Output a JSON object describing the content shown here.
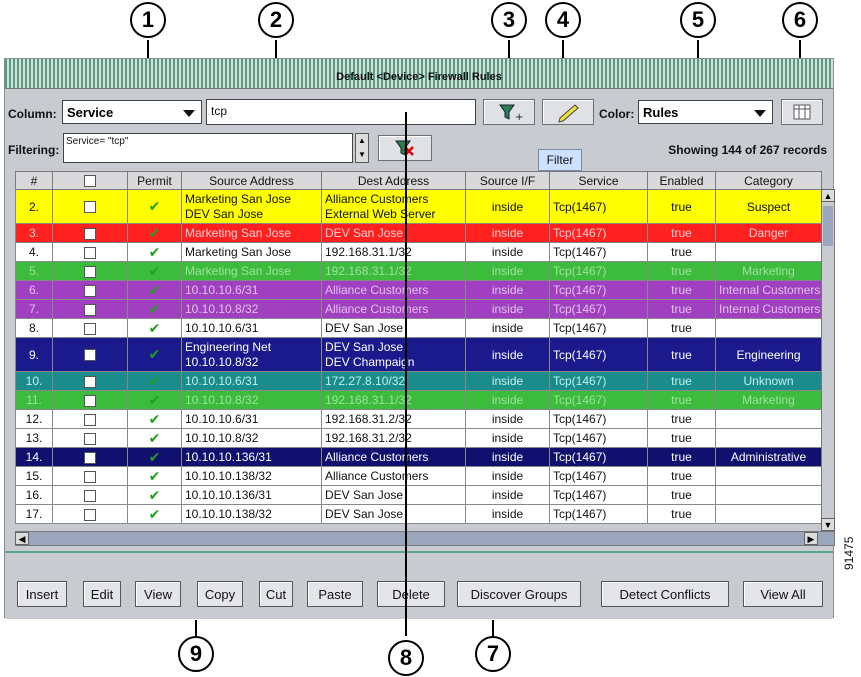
{
  "window": {
    "title": "Default <Device> Firewall Rules"
  },
  "toolbar": {
    "column_label": "Column:",
    "column_value": "Service",
    "filter_text": "tcp",
    "color_label": "Color:",
    "color_value": "Rules",
    "filtering_label": "Filtering:",
    "filtering_expr": "Service= \"tcp\"",
    "tooltip": "Filter",
    "status": "Showing 144 of 267 records"
  },
  "table": {
    "headers": [
      "#",
      "",
      "Permit",
      "Source Address",
      "Dest Address",
      "Source I/F",
      "Service",
      "Enabled",
      "Category"
    ],
    "rows": [
      {
        "num": "2.",
        "src": [
          "Marketing San Jose",
          "DEV San Jose"
        ],
        "dst": [
          "Alliance Customers",
          "External Web Server"
        ],
        "if": "inside",
        "svc": "Tcp(1467)",
        "en": "true",
        "cat": "Suspect",
        "bg": "#ffff00",
        "fg": "#111111",
        "tall": true
      },
      {
        "num": "3.",
        "src": [
          "Marketing San Jose"
        ],
        "dst": [
          "DEV San Jose"
        ],
        "if": "inside",
        "svc": "Tcp(1467)",
        "en": "true",
        "cat": "Danger",
        "bg": "#ff2020",
        "fg": "#ffd0d0"
      },
      {
        "num": "4.",
        "src": [
          "Marketing San Jose"
        ],
        "dst": [
          "192.168.31.1/32"
        ],
        "if": "inside",
        "svc": "Tcp(1467)",
        "en": "true",
        "cat": "",
        "bg": "#ffffff",
        "fg": "#111111"
      },
      {
        "num": "5.",
        "src": [
          "Marketing San Jose"
        ],
        "dst": [
          "192.168.31.1/32"
        ],
        "if": "inside",
        "svc": "Tcp(1467)",
        "en": "true",
        "cat": "Marketing",
        "bg": "#3dbb3d",
        "fg": "#9fe09f"
      },
      {
        "num": "6.",
        "src": [
          "10.10.10.6/31"
        ],
        "dst": [
          "Alliance Customers"
        ],
        "if": "inside",
        "svc": "Tcp(1467)",
        "en": "true",
        "cat": "Internal Customers",
        "bg": "#a040c0",
        "fg": "#e0c0f0"
      },
      {
        "num": "7.",
        "src": [
          "10.10.10.8/32"
        ],
        "dst": [
          "Alliance Customers"
        ],
        "if": "inside",
        "svc": "Tcp(1467)",
        "en": "true",
        "cat": "Internal Customers",
        "bg": "#a040c0",
        "fg": "#e0c0f0"
      },
      {
        "num": "8.",
        "src": [
          "10.10.10.6/31"
        ],
        "dst": [
          "DEV San Jose"
        ],
        "if": "inside",
        "svc": "Tcp(1467)",
        "en": "true",
        "cat": "",
        "bg": "#ffffff",
        "fg": "#111111"
      },
      {
        "num": "9.",
        "src": [
          "Engineering Net",
          "10.10.10.8/32"
        ],
        "dst": [
          "DEV San Jose",
          "DEV Champaign"
        ],
        "if": "inside",
        "svc": "Tcp(1467)",
        "en": "true",
        "cat": "Engineering",
        "bg": "#1a1a8c",
        "fg": "#ffffff",
        "tall": true
      },
      {
        "num": "10.",
        "src": [
          "10.10.10.6/31"
        ],
        "dst": [
          "172.27.8.10/32"
        ],
        "if": "inside",
        "svc": "Tcp(1467)",
        "en": "true",
        "cat": "Unknown",
        "bg": "#1a8c8c",
        "fg": "#c0f0f0"
      },
      {
        "num": "11.",
        "src": [
          "10.10.10.8/32"
        ],
        "dst": [
          "192.168.31.1/32"
        ],
        "if": "inside",
        "svc": "Tcp(1467)",
        "en": "true",
        "cat": "Marketing",
        "bg": "#3dbb3d",
        "fg": "#9fe09f"
      },
      {
        "num": "12.",
        "src": [
          "10.10.10.6/31"
        ],
        "dst": [
          "192.168.31.2/32"
        ],
        "if": "inside",
        "svc": "Tcp(1467)",
        "en": "true",
        "cat": "",
        "bg": "#ffffff",
        "fg": "#111111"
      },
      {
        "num": "13.",
        "src": [
          "10.10.10.8/32"
        ],
        "dst": [
          "192.168.31.2/32"
        ],
        "if": "inside",
        "svc": "Tcp(1467)",
        "en": "true",
        "cat": "",
        "bg": "#ffffff",
        "fg": "#111111"
      },
      {
        "num": "14.",
        "src": [
          "10.10.10.136/31"
        ],
        "dst": [
          "Alliance Customers"
        ],
        "if": "inside",
        "svc": "Tcp(1467)",
        "en": "true",
        "cat": "Administrative",
        "bg": "#10106e",
        "fg": "#ffffff"
      },
      {
        "num": "15.",
        "src": [
          "10.10.10.138/32"
        ],
        "dst": [
          "Alliance Customers"
        ],
        "if": "inside",
        "svc": "Tcp(1467)",
        "en": "true",
        "cat": "",
        "bg": "#ffffff",
        "fg": "#111111"
      },
      {
        "num": "16.",
        "src": [
          "10.10.10.136/31"
        ],
        "dst": [
          "DEV San Jose"
        ],
        "if": "inside",
        "svc": "Tcp(1467)",
        "en": "true",
        "cat": "",
        "bg": "#ffffff",
        "fg": "#111111"
      },
      {
        "num": "17.",
        "src": [
          "10.10.10.138/32"
        ],
        "dst": [
          "DEV San Jose"
        ],
        "if": "inside",
        "svc": "Tcp(1467)",
        "en": "true",
        "cat": "",
        "bg": "#ffffff",
        "fg": "#111111"
      }
    ]
  },
  "buttons": {
    "insert": "Insert",
    "edit": "Edit",
    "view": "View",
    "copy": "Copy",
    "cut": "Cut",
    "paste": "Paste",
    "delete": "Delete",
    "discover": "Discover Groups",
    "detect": "Detect Conflicts",
    "view_all": "View All"
  },
  "callouts": [
    "1",
    "2",
    "3",
    "4",
    "5",
    "6",
    "7",
    "8",
    "9"
  ],
  "figure_number": "91475"
}
